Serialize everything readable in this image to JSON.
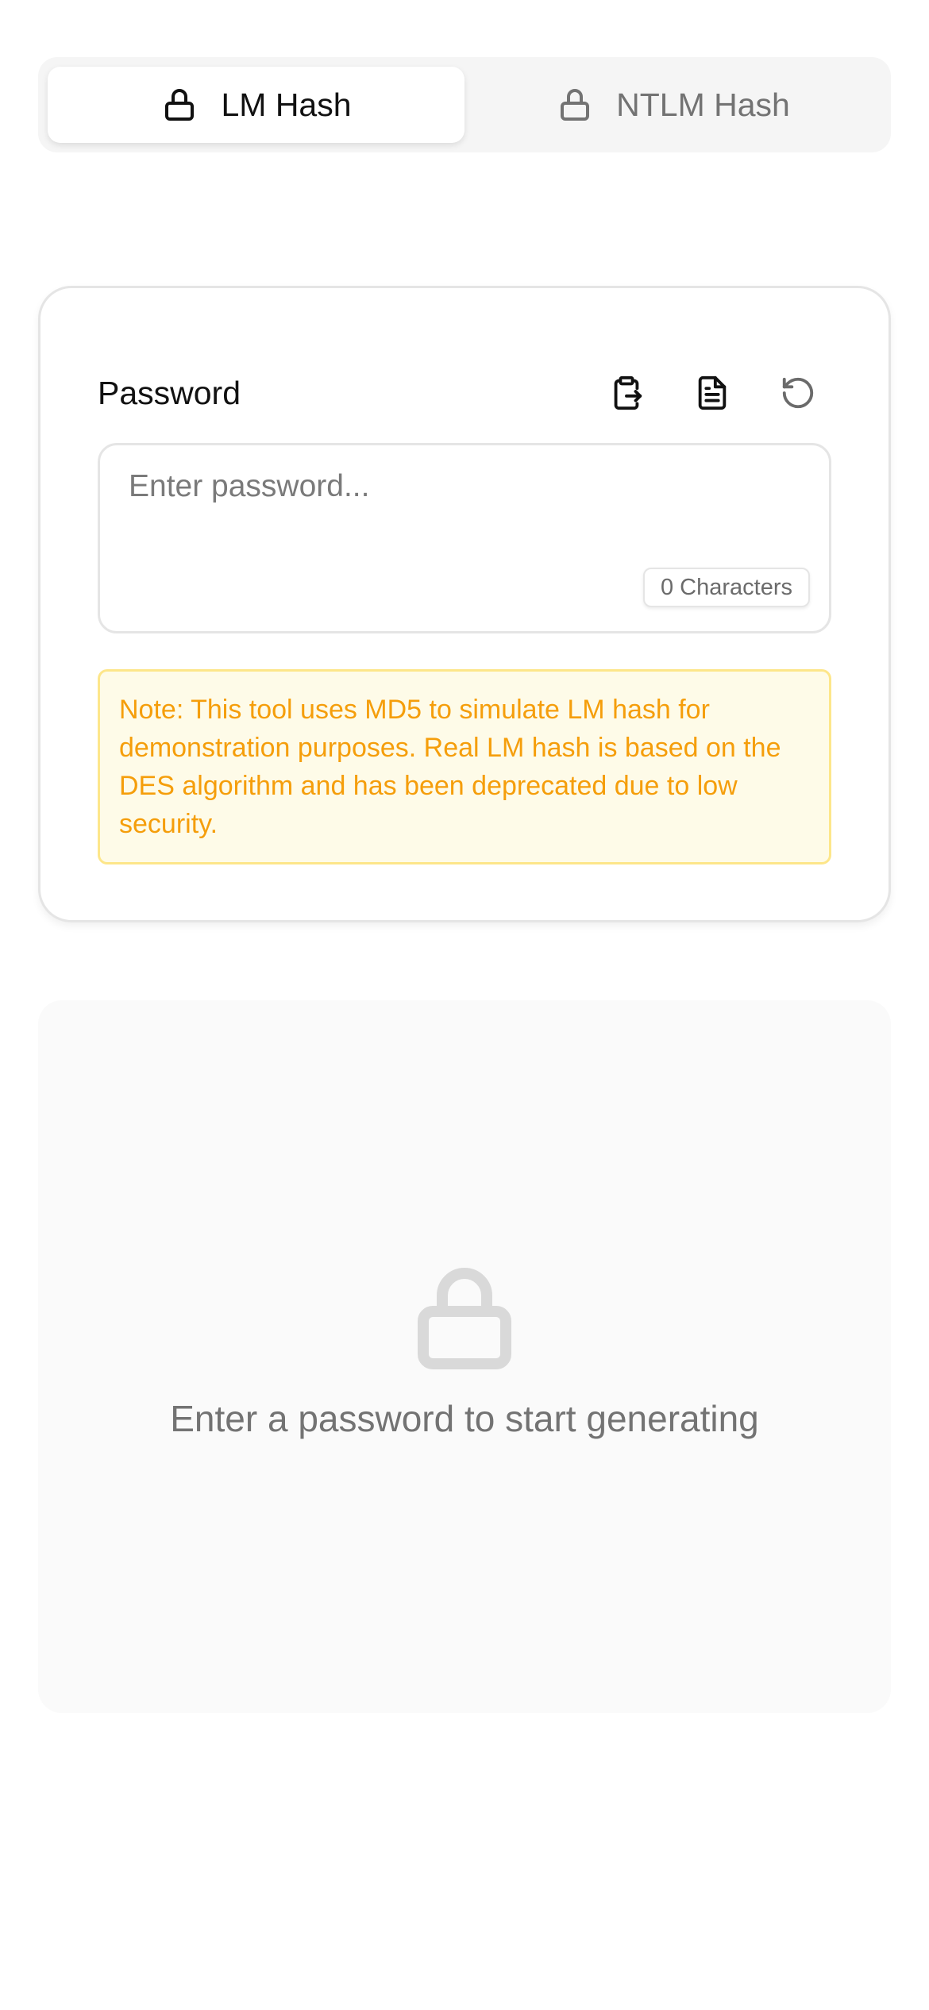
{
  "tabs": [
    {
      "label": "LM Hash",
      "icon": "lock-icon",
      "active": true
    },
    {
      "label": "NTLM Hash",
      "icon": "lock-icon",
      "active": false
    }
  ],
  "password": {
    "label": "Password",
    "placeholder": "Enter password...",
    "value": "",
    "char_count": "0 Characters",
    "actions": [
      "paste-icon",
      "file-text-icon",
      "reset-icon"
    ]
  },
  "note": "Note: This tool uses MD5 to simulate LM hash for demonstration purposes. Real LM hash is based on the DES algorithm and has been deprecated due to low security.",
  "empty_state": {
    "icon": "lock-icon",
    "text": "Enter a password to start generating"
  },
  "colors": {
    "note_text": "#f59e0b",
    "note_bg": "#fefbe8",
    "note_border": "#fde68a",
    "muted_text": "#737373"
  }
}
